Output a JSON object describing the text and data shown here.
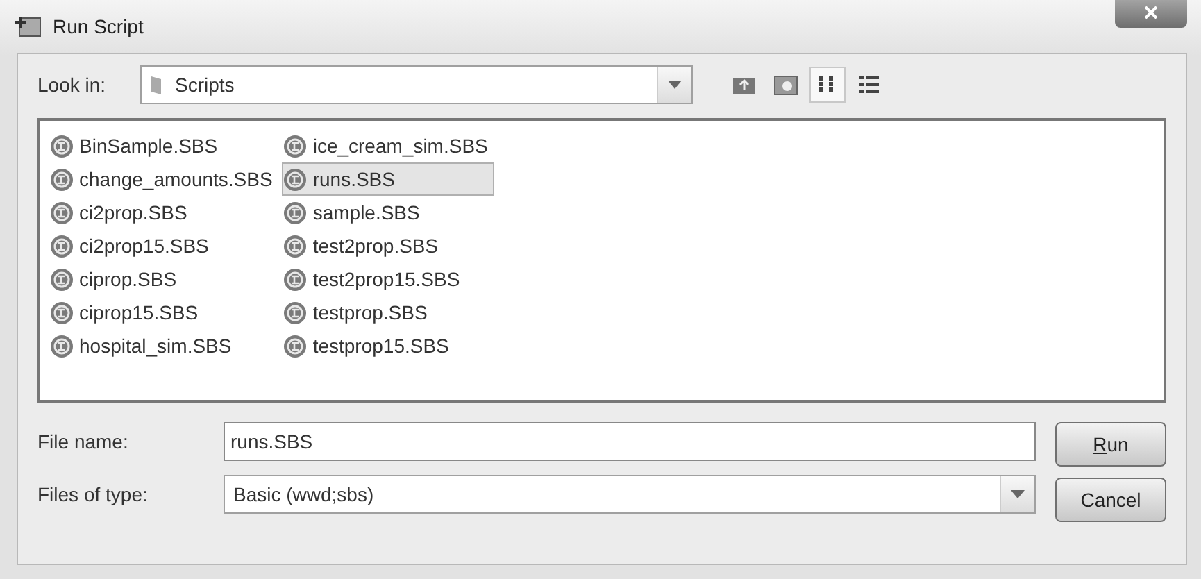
{
  "window": {
    "title": "Run Script"
  },
  "look_in": {
    "label": "Look in:",
    "value": "Scripts"
  },
  "view_buttons": [
    {
      "kind": "up",
      "selected": false
    },
    {
      "kind": "new_folder",
      "selected": false
    },
    {
      "kind": "list",
      "selected": true
    },
    {
      "kind": "details",
      "selected": false
    }
  ],
  "files": [
    {
      "name": "BinSample.SBS",
      "selected": false
    },
    {
      "name": "change_amounts.SBS",
      "selected": false
    },
    {
      "name": "ci2prop.SBS",
      "selected": false
    },
    {
      "name": "ci2prop15.SBS",
      "selected": false
    },
    {
      "name": "ciprop.SBS",
      "selected": false
    },
    {
      "name": "ciprop15.SBS",
      "selected": false
    },
    {
      "name": "hospital_sim.SBS",
      "selected": false
    },
    {
      "name": "ice_cream_sim.SBS",
      "selected": false
    },
    {
      "name": "runs.SBS",
      "selected": true
    },
    {
      "name": "sample.SBS",
      "selected": false
    },
    {
      "name": "test2prop.SBS",
      "selected": false
    },
    {
      "name": "test2prop15.SBS",
      "selected": false
    },
    {
      "name": "testprop.SBS",
      "selected": false
    },
    {
      "name": "testprop15.SBS",
      "selected": false
    }
  ],
  "file_name": {
    "label": "File name:",
    "value": "runs.SBS"
  },
  "file_type": {
    "label": "Files of type:",
    "value": "Basic (wwd;sbs)"
  },
  "buttons": [
    {
      "label": "Run",
      "mnemonic": true
    },
    {
      "label": "Cancel",
      "mnemonic": false
    }
  ]
}
